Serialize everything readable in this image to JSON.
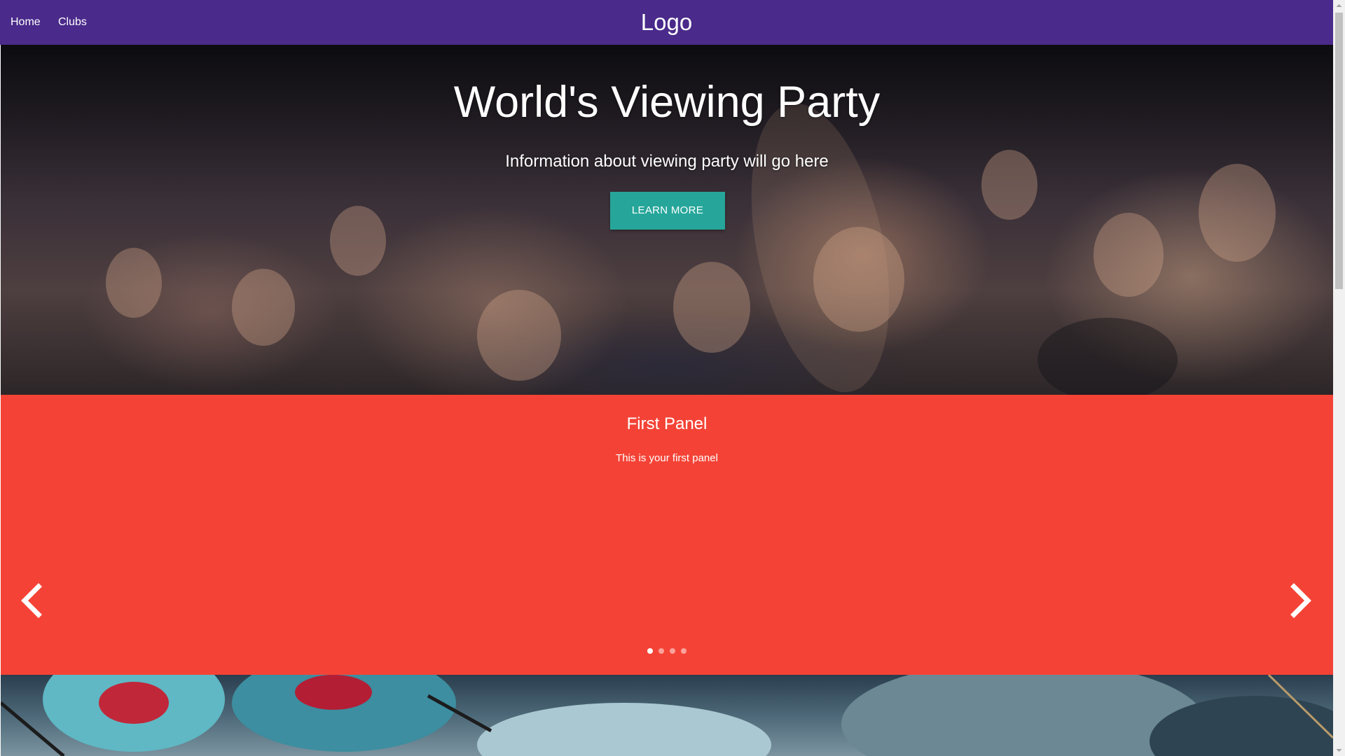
{
  "nav": {
    "items": [
      {
        "label": "Home"
      },
      {
        "label": "Clubs"
      }
    ],
    "logo": "Logo"
  },
  "hero": {
    "title": "World's Viewing Party",
    "subtitle": "Information about viewing party will go here",
    "button_label": "LEARN MORE"
  },
  "carousel": {
    "panel_title": "First Panel",
    "panel_text": "This is your first panel",
    "active_index": 0,
    "panel_count": 4,
    "icons": {
      "prev": "chevron-left-icon",
      "next": "chevron-right-icon"
    }
  },
  "colors": {
    "nav_bg": "#4a2a8a",
    "button_bg": "#26a69a",
    "carousel_bg": "#f44336"
  }
}
